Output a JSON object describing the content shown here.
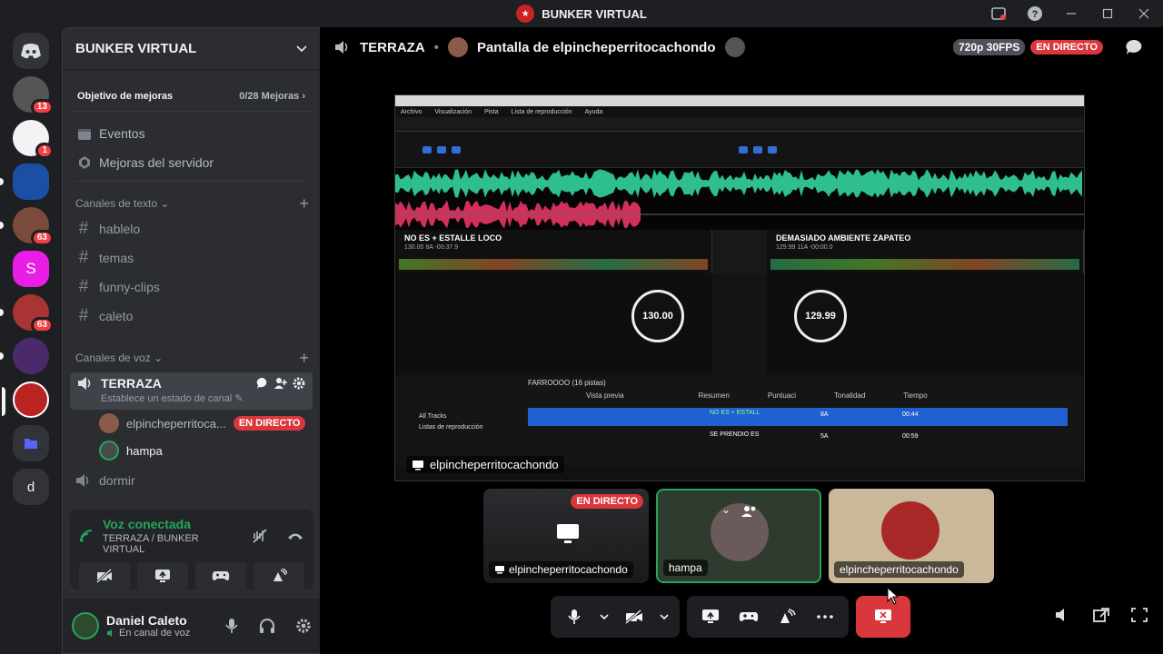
{
  "window": {
    "title": "BUNKER VIRTUAL"
  },
  "servers": [
    {
      "badge": ""
    },
    {
      "badge": "13"
    },
    {
      "badge": "1"
    },
    {
      "badge": ""
    },
    {
      "badge": "63"
    },
    {
      "badge": ""
    },
    {
      "badge": "63"
    },
    {
      "badge": ""
    },
    {
      "badge": ""
    },
    {
      "badge": ""
    },
    {
      "badge": "d"
    }
  ],
  "sidebar": {
    "guild_name": "BUNKER VIRTUAL",
    "boost_label": "Objetivo de mejoras",
    "boost_progress": "0/28 Mejoras",
    "items": [
      "Eventos",
      "Mejoras del servidor"
    ],
    "text_category": "Canales de texto",
    "text_channels": [
      "hablelo",
      "temas",
      "funny-clips",
      "caleto"
    ],
    "voice_category": "Canales de voz",
    "active_voice": {
      "name": "TERRAZA",
      "status": "Establece un estado de canal",
      "users": [
        {
          "name": "elpincheperritoca...",
          "live": "EN DIRECTO"
        },
        {
          "name": "hampa",
          "live": ""
        }
      ]
    },
    "other_voice": "dormir"
  },
  "voice_panel": {
    "status": "Voz conectada",
    "location": "TERRAZA / BUNKER VIRTUAL"
  },
  "user": {
    "name": "Daniel Caleto",
    "status": "En canal de voz"
  },
  "stage": {
    "channel": "TERRAZA",
    "stream_title": "Pantalla de elpincheperritocachondo",
    "quality": "720p 30FPS",
    "live": "EN DIRECTO",
    "stream_owner": "elpincheperritocachondo",
    "tiles": [
      {
        "label": "elpincheperritocachondo",
        "live": "EN DIRECTO"
      },
      {
        "label": "hampa",
        "live": ""
      },
      {
        "label": "elpincheperritocachondo",
        "live": ""
      }
    ]
  },
  "dj": {
    "menu": [
      "Archivo",
      "Visualización",
      "Pista",
      "Lista de reproducción",
      "Ayuda"
    ],
    "deck1_title": "NO ES + ESTALLE LOCO",
    "deck1_sub": "130.00 8A    -00:37.9",
    "deck2_title": "DEMASIADO AMBIENTE ZAPATEO",
    "deck2_sub": "129.99 11A    -00:00.0",
    "bpm1": "130.00",
    "bpm2": "129.99",
    "playlist": "FARROOOO (16 pistas)",
    "columns": [
      "Vista previa",
      "Resumen",
      "Puntuaci",
      "Tonalidad",
      "Tiempo"
    ],
    "rows": [
      {
        "title": "NO ES + ESTALL",
        "key": "8A",
        "time": "00:44"
      },
      {
        "title": "SE PRENDIO ES",
        "key": "5A",
        "time": "00:59"
      }
    ],
    "tree": [
      "All Tracks",
      "Listas de reproducción"
    ]
  },
  "colors": {
    "accent_live": "#da373c",
    "voice_green": "#23a55a"
  }
}
